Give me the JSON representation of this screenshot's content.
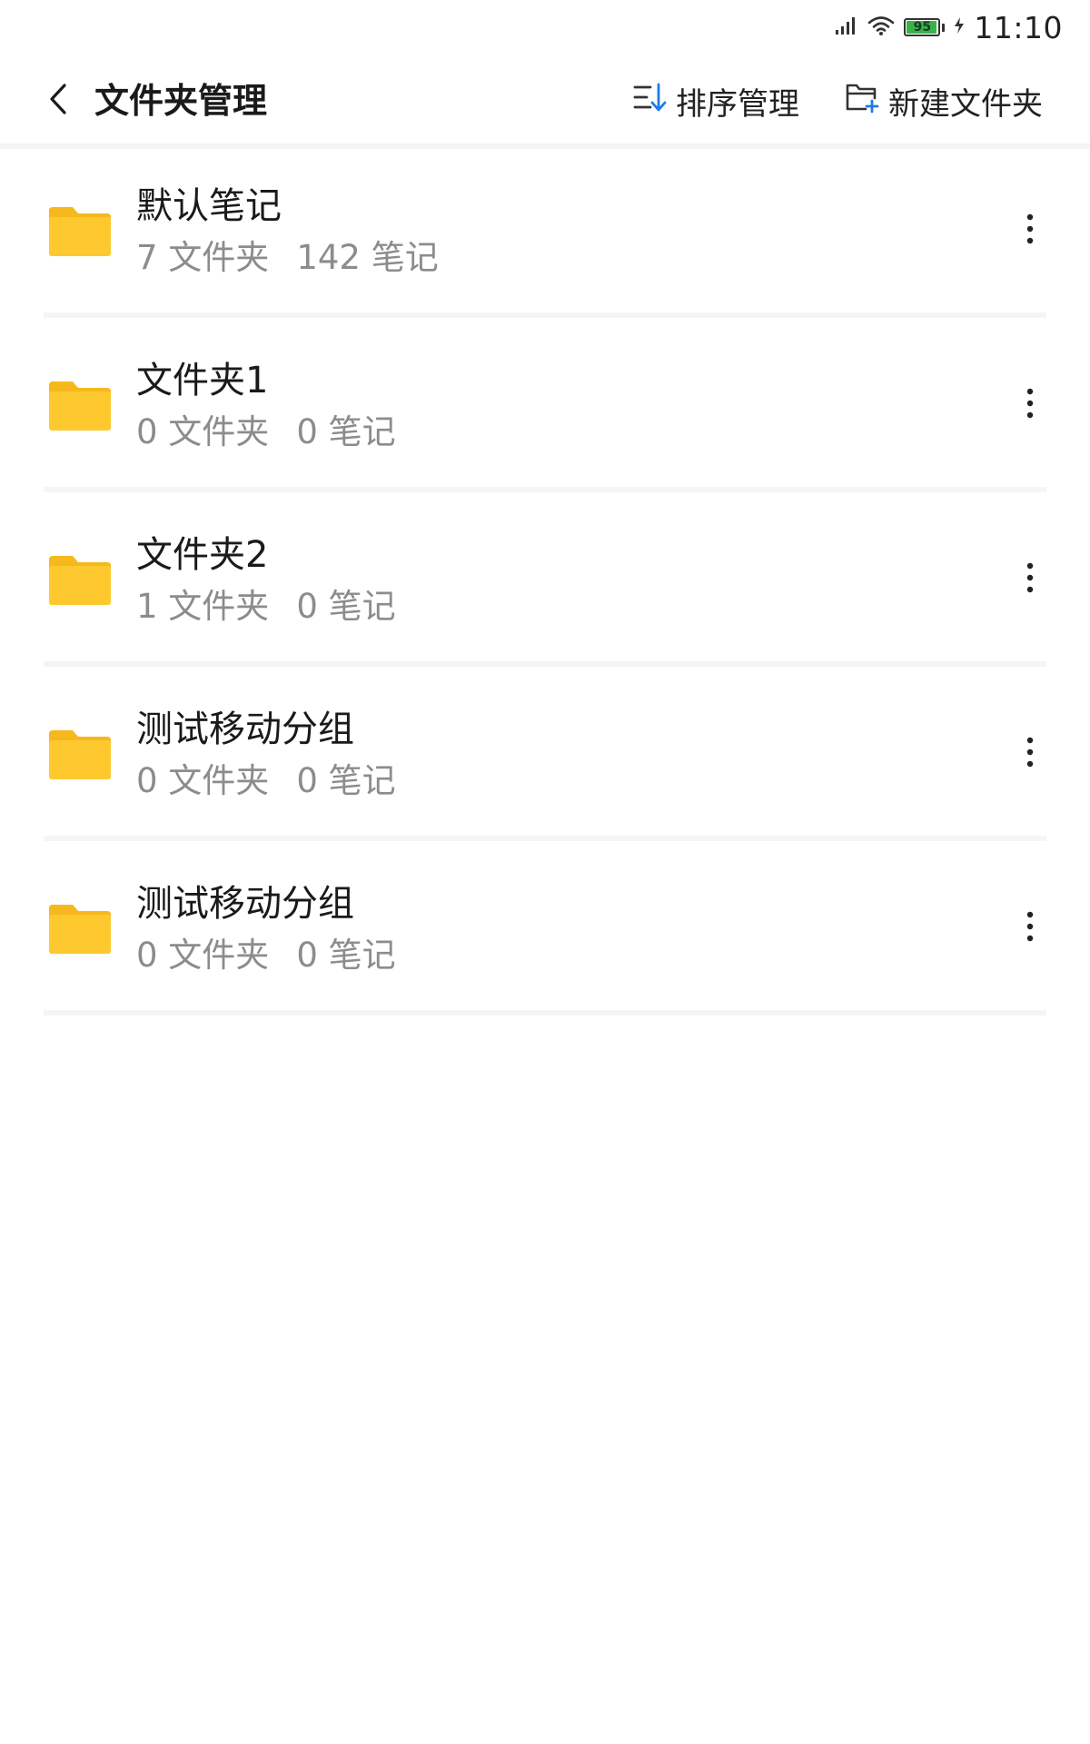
{
  "status_bar": {
    "time": "11:10",
    "battery_level": "95",
    "battery_fraction": 0.95,
    "signal_icon": "cellular-signal-icon",
    "wifi_icon": "wifi-icon",
    "charging_icon": "charging-bolt-icon"
  },
  "header": {
    "back_icon": "chevron-left-icon",
    "title": "文件夹管理",
    "sort_label": "排序管理",
    "sort_icon": "sort-icon",
    "new_folder_label": "新建文件夹",
    "new_folder_icon": "folder-add-icon"
  },
  "folders": [
    {
      "name": "默认笔记",
      "folders_label": "7 文件夹",
      "notes_label": "142 笔记"
    },
    {
      "name": "文件夹1",
      "folders_label": "0 文件夹",
      "notes_label": "0 笔记"
    },
    {
      "name": "文件夹2",
      "folders_label": "1 文件夹",
      "notes_label": "0 笔记"
    },
    {
      "name": "测试移动分组",
      "folders_label": "0 文件夹",
      "notes_label": "0 笔记"
    },
    {
      "name": "测试移动分组",
      "folders_label": "0 文件夹",
      "notes_label": "0 笔记"
    }
  ],
  "colors": {
    "folder_yellow": "#FDC92F",
    "folder_tab": "#F6B81C",
    "accent_blue": "#1E7BE8",
    "battery_green": "#37B34A"
  }
}
